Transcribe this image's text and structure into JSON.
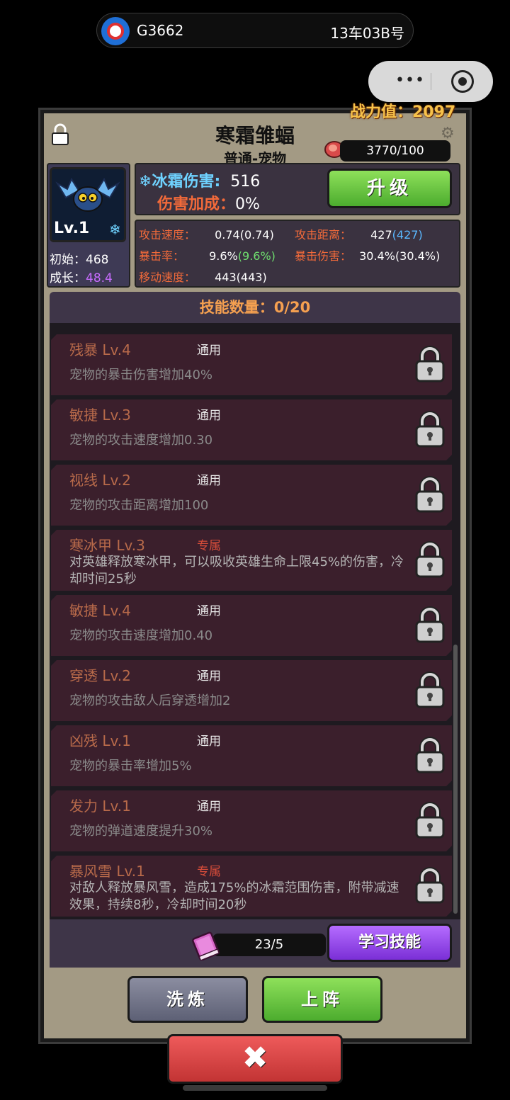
{
  "status_bar": {
    "train_number": "G3662",
    "seat": "13车03B号",
    "logo_text": "中国铁路"
  },
  "capsule": {
    "more_icon": "more-dots-icon",
    "close_icon": "target-icon"
  },
  "pet": {
    "power_label": "战力值：2097",
    "name": "寒霜雏蝠",
    "type": "普通-宠物",
    "food": "3770/100",
    "level": "Lv.1",
    "initial_label": "初始：",
    "initial_value": "468",
    "growth_label": "成长：",
    "growth_value": "48.4",
    "damage_type_label": "冰霜伤害:",
    "damage_type_value": "516",
    "damage_bonus_label": "伤害加成：",
    "damage_bonus_value": "0%",
    "upgrade_button": "升级"
  },
  "stats": {
    "attack_speed": {
      "label": "攻击速度：",
      "value": "0.74",
      "extra": "(0.74)"
    },
    "attack_range": {
      "label": "攻击距离：",
      "value": "427",
      "extra": "(427)"
    },
    "crit_rate": {
      "label": "暴击率：",
      "value": "9.6%",
      "extra": "(9.6%)"
    },
    "crit_damage": {
      "label": "暴击伤害：",
      "value": "30.4%",
      "extra": "(30.4%)"
    },
    "move_speed": {
      "label": "移动速度：",
      "value": "443",
      "extra": "(443)"
    }
  },
  "skills_header": "技能数量：0/20",
  "skills": [
    {
      "name": "残暴 Lv.4",
      "tag": "通用",
      "exclusive": false,
      "desc": "宠物的暴击伤害增加40%"
    },
    {
      "name": "敏捷 Lv.3",
      "tag": "通用",
      "exclusive": false,
      "desc": "宠物的攻击速度增加0.30"
    },
    {
      "name": "视线 Lv.2",
      "tag": "通用",
      "exclusive": false,
      "desc": "宠物的攻击距离增加100"
    },
    {
      "name": "寒冰甲 Lv.3",
      "tag": "专属",
      "exclusive": true,
      "desc": "对英雄释放寒冰甲，可以吸收英雄生命上限45%的伤害，冷却时间25秒"
    },
    {
      "name": "敏捷 Lv.4",
      "tag": "通用",
      "exclusive": false,
      "desc": "宠物的攻击速度增加0.40"
    },
    {
      "name": "穿透 Lv.2",
      "tag": "通用",
      "exclusive": false,
      "desc": "宠物的攻击敌人后穿透增加2"
    },
    {
      "name": "凶残 Lv.1",
      "tag": "通用",
      "exclusive": false,
      "desc": "宠物的暴击率增加5%"
    },
    {
      "name": "发力 Lv.1",
      "tag": "通用",
      "exclusive": false,
      "desc": "宠物的弹道速度提升30%"
    },
    {
      "name": "暴风雪 Lv.1",
      "tag": "专属",
      "exclusive": true,
      "desc": "对敌人释放暴风雪，造成175%的冰霜范围伤害，附带减速效果，持续8秒，冷却时间20秒"
    }
  ],
  "learn": {
    "book_count": "23/5",
    "learn_button": "学习技能"
  },
  "actions": {
    "wash": "洗炼",
    "deploy": "上阵",
    "close_icon": "close-x-icon"
  },
  "colors": {
    "accent_green": "#5cc03a",
    "accent_purple": "#9040e8",
    "accent_red": "#d84444",
    "power_gold": "#f7c24a"
  }
}
